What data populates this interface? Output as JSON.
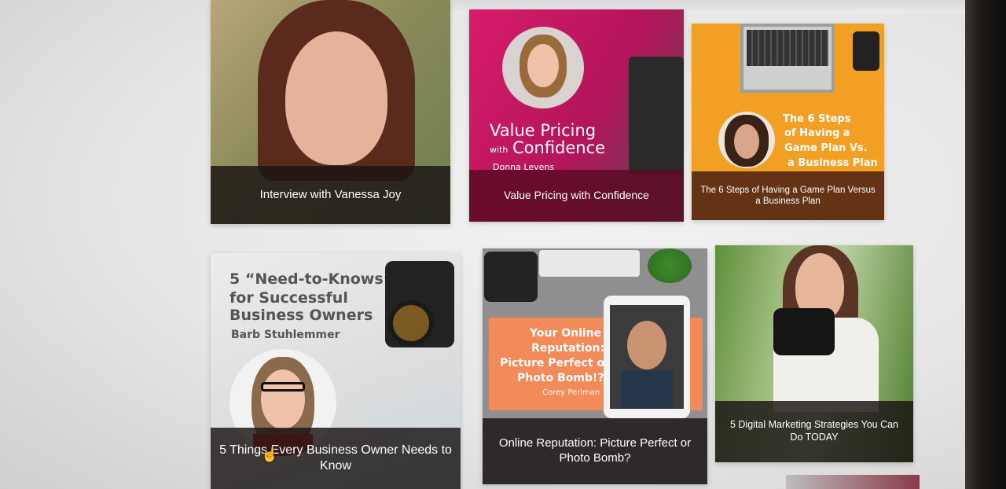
{
  "cards": [
    {
      "caption": "Interview with Vanessa Joy"
    },
    {
      "caption": "Value Pricing with Confidence",
      "art_line1": "Value Pricing",
      "art_with": "with",
      "art_line2": "Confidence",
      "art_author": "Donna Levens"
    },
    {
      "caption": "The 6 Steps of Having a Game Plan Versus a Business Plan",
      "art_l1": "The 6 Steps",
      "art_l2": "of Having a",
      "art_l3": "Game Plan Vs.",
      "art_l4": "a Business Plan"
    },
    {
      "caption": "5 Things Every Business Owner Needs to Know",
      "art_l1": "5 “Need-to-Knows”",
      "art_l2": "for Successful",
      "art_l3": "Business Owners",
      "art_author": "Barb Stuhlemmer"
    },
    {
      "caption": "Online Reputation: Picture Perfect or Photo Bomb?",
      "art_l1": "Your Online",
      "art_l2": "Reputation:",
      "art_l3": "Picture Perfect or",
      "art_l4": "Photo Bomb!?",
      "art_author": "Corey Perlman"
    },
    {
      "caption": "5 Digital Marketing Strategies You Can Do TODAY"
    }
  ],
  "colors": {
    "pink": "#c2185b",
    "orange": "#f2a024",
    "caption_bg": "#1c1715"
  }
}
